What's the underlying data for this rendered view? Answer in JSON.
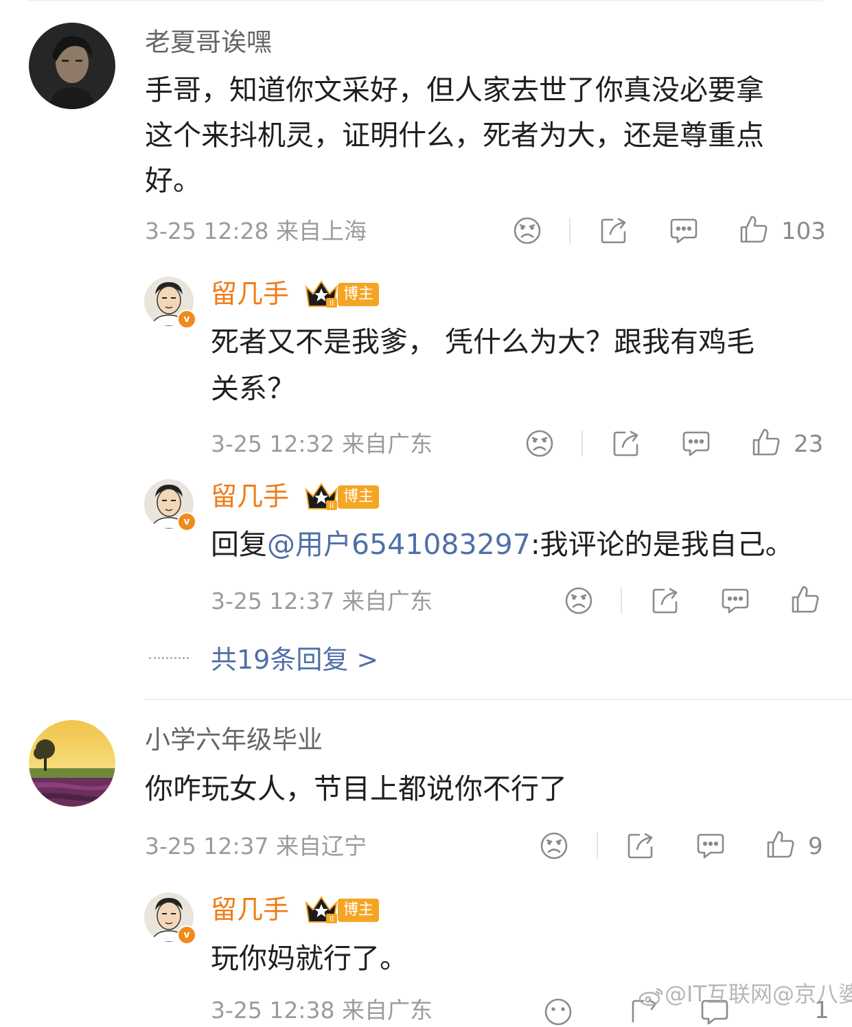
{
  "comments": [
    {
      "username": "老夏哥诶嘿",
      "content_lines": [
        "手哥，知道你文采好，但人家去世了你真没必要拿",
        "这个来抖机灵，证明什么，死者为大，还是尊重点",
        "好。"
      ],
      "time": "3-25 12:28",
      "location": "来自上海",
      "likes": "103",
      "replies": [
        {
          "username": "留几手",
          "badge": "博主",
          "content_lines": [
            "死者又不是我爹， 凭什么为大？跟我有鸡毛",
            "关系？"
          ],
          "time": "3-25 12:32",
          "location": "来自广东",
          "likes": "23"
        },
        {
          "username": "留几手",
          "badge": "博主",
          "reply_prefix": "回复",
          "mention": "@用户6541083297",
          "reply_text": ":我评论的是我自己。",
          "time": "3-25 12:37",
          "location": "来自广东",
          "likes": ""
        }
      ],
      "more_replies": "共19条回复 >"
    },
    {
      "username": "小学六年级毕业",
      "content_lines": [
        "你咋玩女人，节目上都说你不行了"
      ],
      "time": "3-25 12:37",
      "location": "来自辽宁",
      "likes": "9",
      "replies": [
        {
          "username": "留几手",
          "badge": "博主",
          "content_lines": [
            "玩你妈就行了。"
          ],
          "time": "3-25 12:38",
          "location": "来自广东",
          "likes": "1"
        }
      ]
    }
  ],
  "watermark": "@IT互联网@京八婆",
  "colors": {
    "accent_orange": "#f07a13",
    "badge_orange": "#f5a524",
    "link_blue": "#4f6fa8",
    "meta_gray": "#9b9b9b"
  },
  "icons": {
    "action_row": [
      "dislike-icon",
      "share-icon",
      "comment-icon",
      "like-icon"
    ],
    "verified": "v-badge-icon",
    "crown": "crown-icon"
  }
}
